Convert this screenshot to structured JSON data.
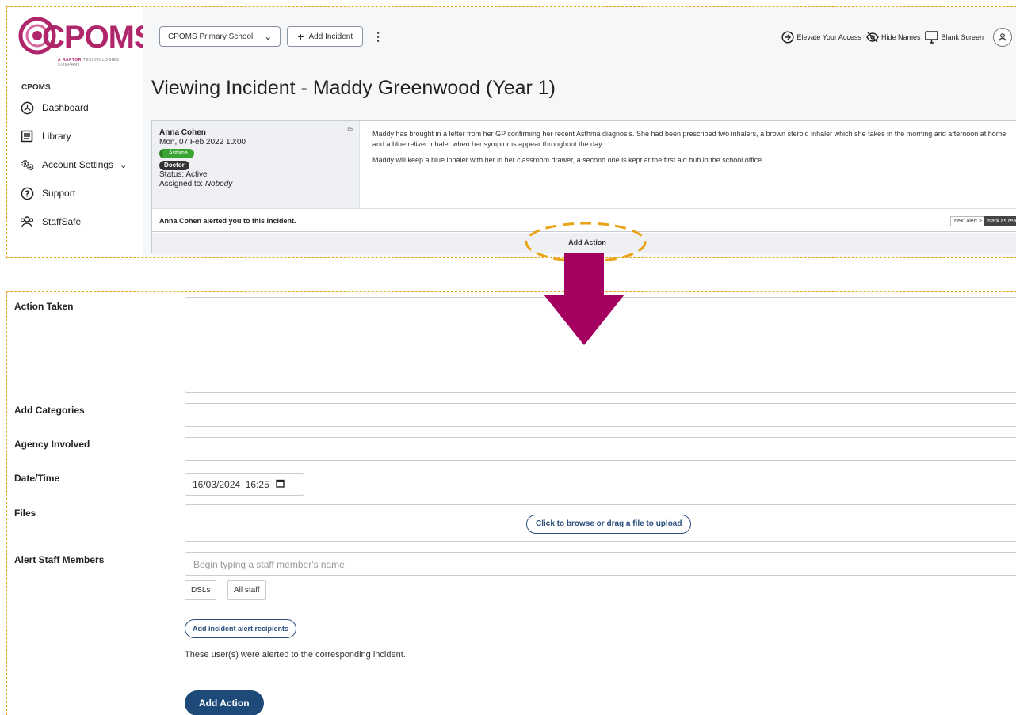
{
  "logo": {
    "word": "CPOMS",
    "tagline_brand": "A RAPTOR",
    "tagline_rest": " TECHNOLOGIES COMPANY",
    "color": "#b0266a"
  },
  "sidebar": {
    "brand_label": "CPOMS",
    "items": [
      {
        "label": "Dashboard",
        "icon": "dashboard-icon"
      },
      {
        "label": "Library",
        "icon": "book-icon"
      },
      {
        "label": "Account Settings",
        "icon": "gears-icon"
      },
      {
        "label": "Support",
        "icon": "help-icon"
      },
      {
        "label": "StaffSafe",
        "icon": "staff-icon"
      }
    ]
  },
  "toolbar": {
    "school": "CPOMS Primary School",
    "add_incident": "Add Incident",
    "elevate": "Elevate Your Access",
    "hide_names": "Hide Names",
    "blank_screen": "Blank Screen"
  },
  "page": {
    "title": "Viewing Incident - Maddy Greenwood (Year 1)"
  },
  "incident": {
    "author": "Anna Cohen",
    "id": "85",
    "date": "Mon, 07 Feb 2022 10:00",
    "category": "Asthma",
    "agency": "Doctor",
    "status": "Status: Active",
    "assigned_label": "Assigned to: ",
    "assigned_value": "Nobody",
    "body_1": "Maddy has brought in a letter from her GP confirming her recent Asthma diagnosis. She had been prescribed two inhalers, a brown steroid inhaler which she takes in the morning and afternoon at home and a blue reliver inhaler when her symptoms appear throughout the day.",
    "body_2": "Maddy will keep a blue inhaler with her in her classroom drawer, a second one is kept at the first aid hub in the school office.",
    "alert_message": "Anna Cohen alerted you to this incident.",
    "next_alert": "next alert >",
    "mark_read": "mark as read",
    "add_action": "Add Action"
  },
  "form": {
    "action_taken_label": "Action Taken",
    "categories_label": "Add Categories",
    "agency_label": "Agency Involved",
    "datetime_label": "Date/Time",
    "datetime_value": "16/03/2024  16:25",
    "files_label": "Files",
    "upload_label": "Click to browse or drag a file to upload",
    "alert_staff_label": "Alert Staff Members",
    "staff_placeholder": "Begin typing a staff member's name",
    "dsl_label": "DSLs",
    "all_staff_label": "All staff",
    "add_recipients_label": "Add incident alert recipients",
    "alerted_note": "These user(s) were alerted to the corresponding incident.",
    "submit_label": "Add Action"
  },
  "colors": {
    "accent": "#1e4a7a",
    "highlight": "#e8a317",
    "arrow": "#a3005f",
    "tag_green": "#3aa432"
  }
}
